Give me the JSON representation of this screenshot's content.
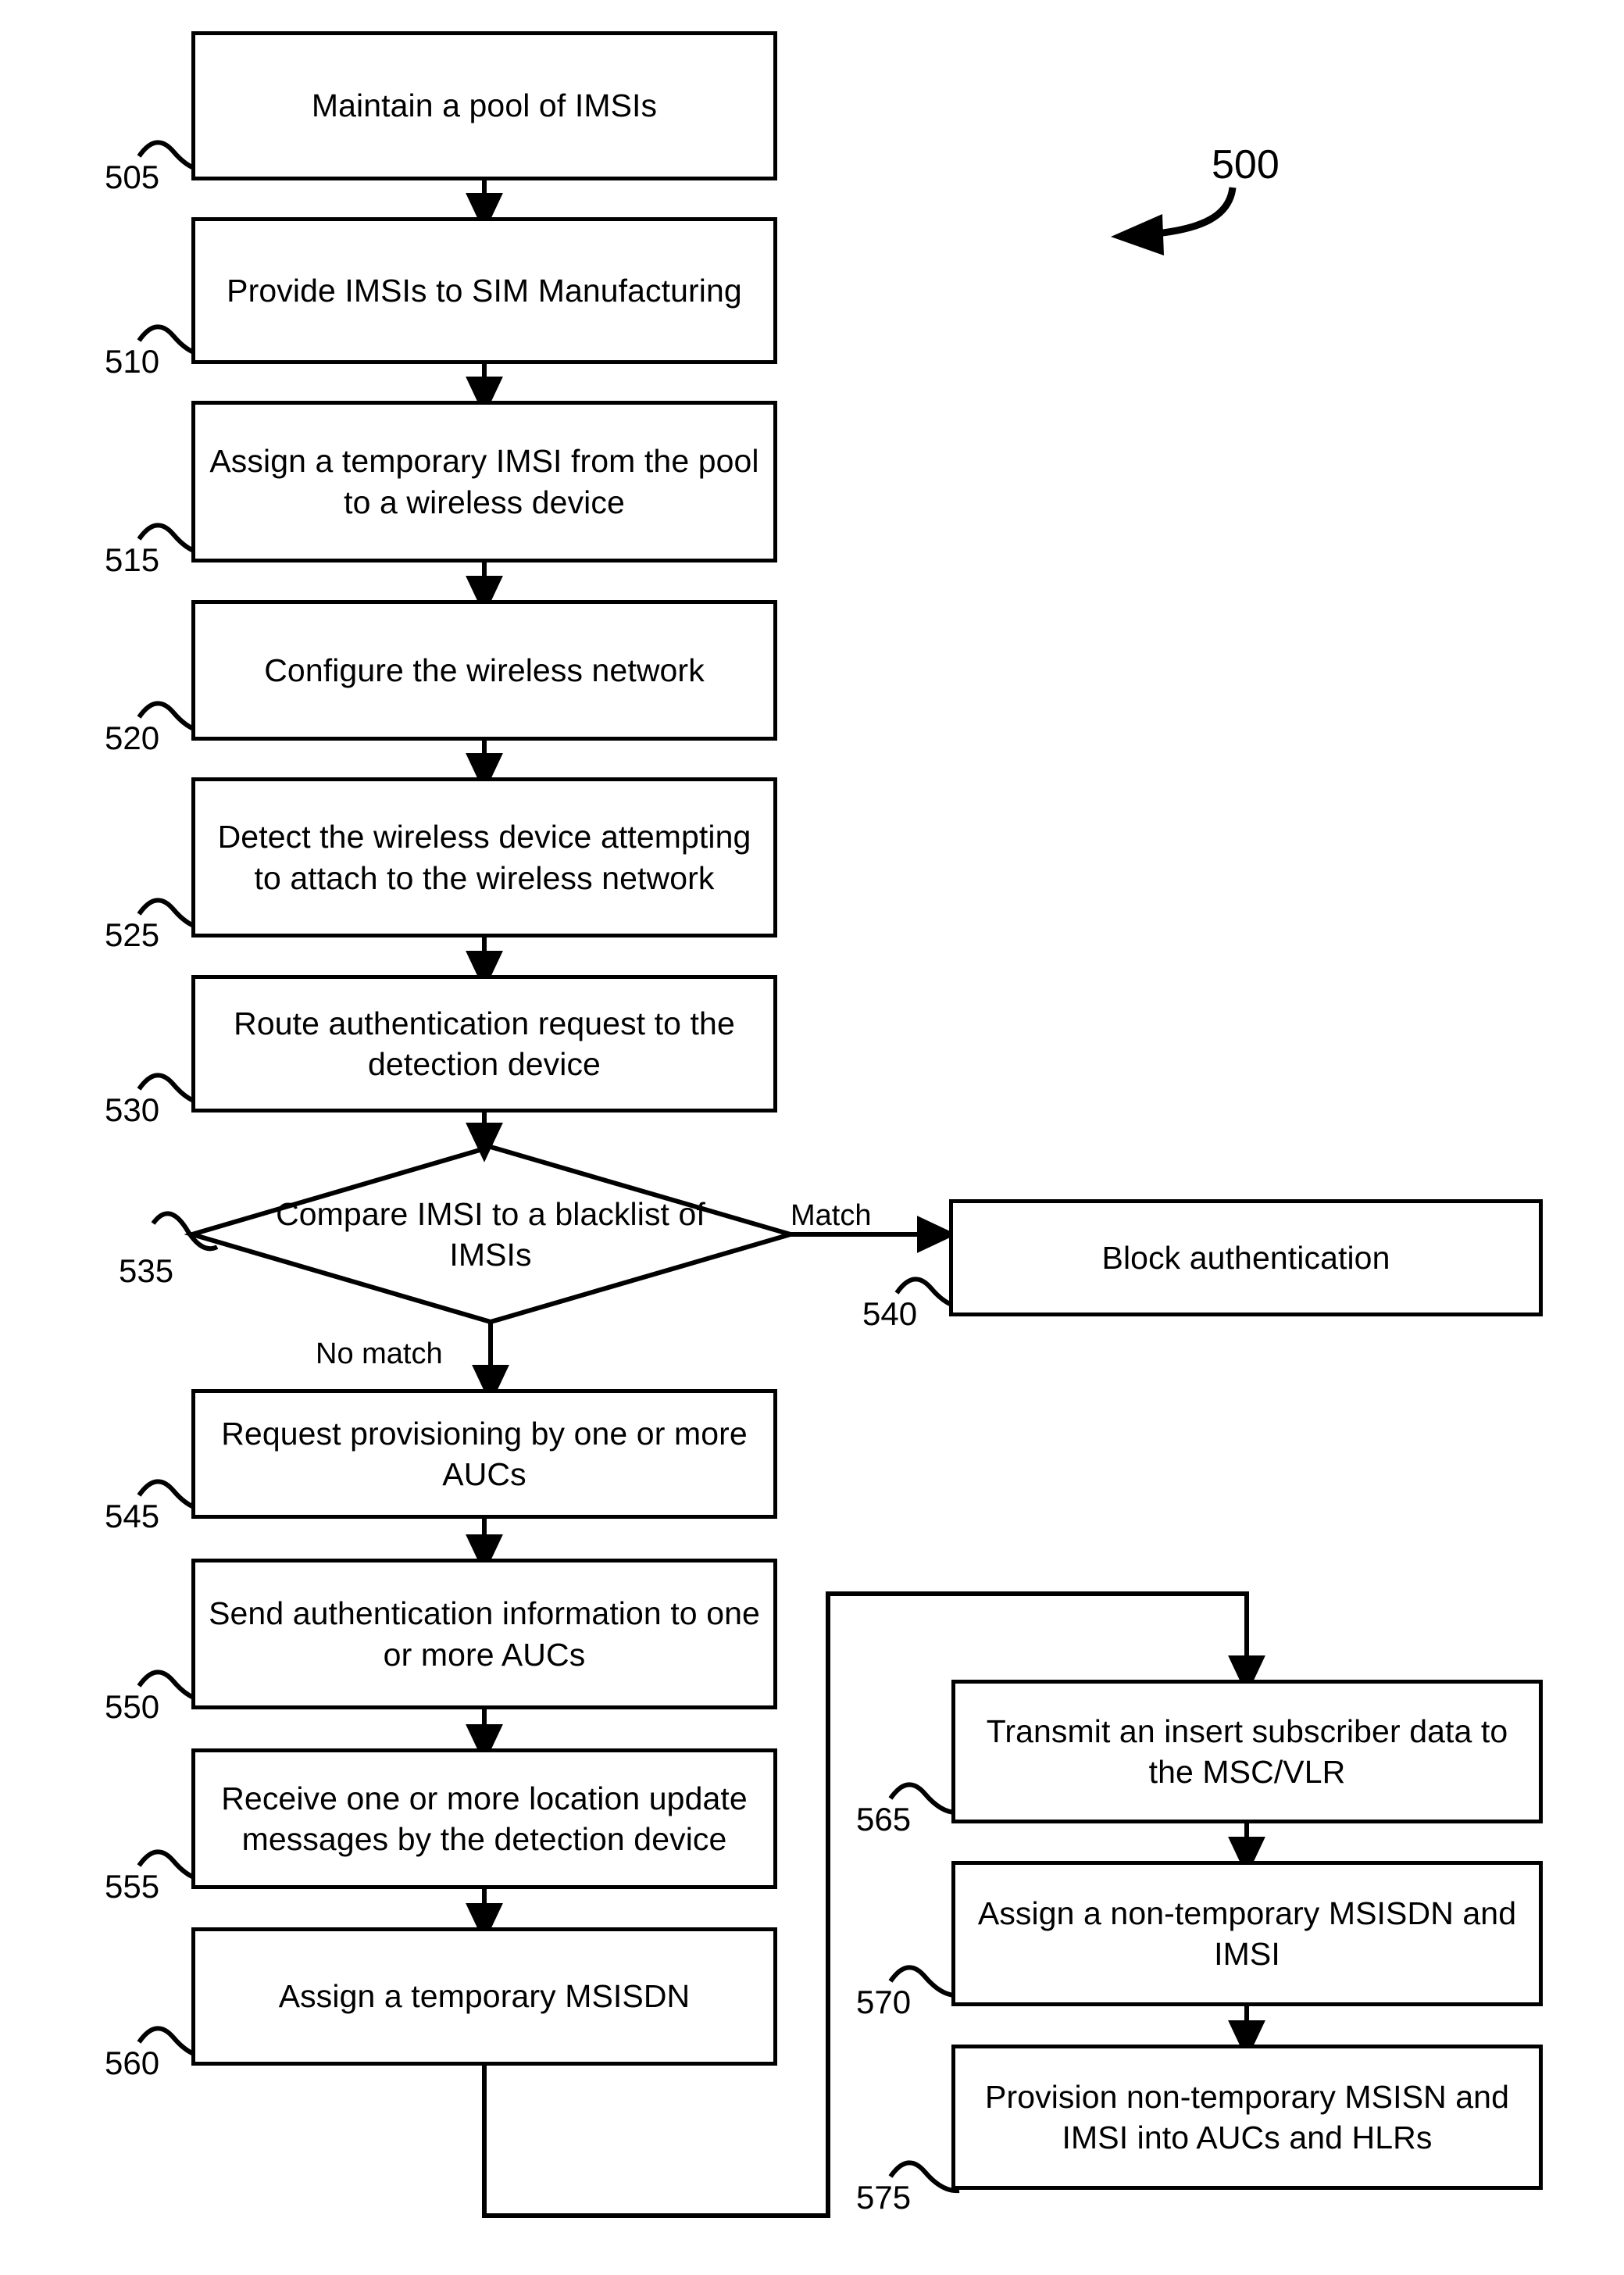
{
  "figure": {
    "tag": "500"
  },
  "nodes": [
    {
      "ref": "505",
      "text": "Maintain a pool of IMSIs",
      "shape": "process"
    },
    {
      "ref": "510",
      "text": "Provide IMSIs to SIM Manufacturing",
      "shape": "process"
    },
    {
      "ref": "515",
      "text": "Assign a temporary IMSI from the pool to a wireless device",
      "shape": "process"
    },
    {
      "ref": "520",
      "text": "Configure the wireless network",
      "shape": "process"
    },
    {
      "ref": "525",
      "text": "Detect the wireless device attempting to attach to the wireless network",
      "shape": "process"
    },
    {
      "ref": "530",
      "text": "Route authentication request to the detection device",
      "shape": "process"
    },
    {
      "ref": "535",
      "text": "Compare IMSI to a blacklist of IMSIs",
      "shape": "decision"
    },
    {
      "ref": "540",
      "text": "Block authentication",
      "shape": "process"
    },
    {
      "ref": "545",
      "text": "Request provisioning by one or more AUCs",
      "shape": "process"
    },
    {
      "ref": "550",
      "text": "Send authentication information to one or more AUCs",
      "shape": "process"
    },
    {
      "ref": "555",
      "text": "Receive one or more location update messages by the detection device",
      "shape": "process"
    },
    {
      "ref": "560",
      "text": "Assign a temporary MSISDN",
      "shape": "process"
    },
    {
      "ref": "565",
      "text": "Transmit an insert subscriber data to the MSC/VLR",
      "shape": "process"
    },
    {
      "ref": "570",
      "text": "Assign a non-temporary MSISDN and IMSI",
      "shape": "process"
    },
    {
      "ref": "575",
      "text": "Provision non-temporary MSISN and IMSI into AUCs and HLRs",
      "shape": "process"
    }
  ],
  "edge_labels": {
    "match": "Match",
    "no_match": "No match"
  },
  "colors": {
    "stroke": "#000000",
    "fill": "#ffffff"
  }
}
